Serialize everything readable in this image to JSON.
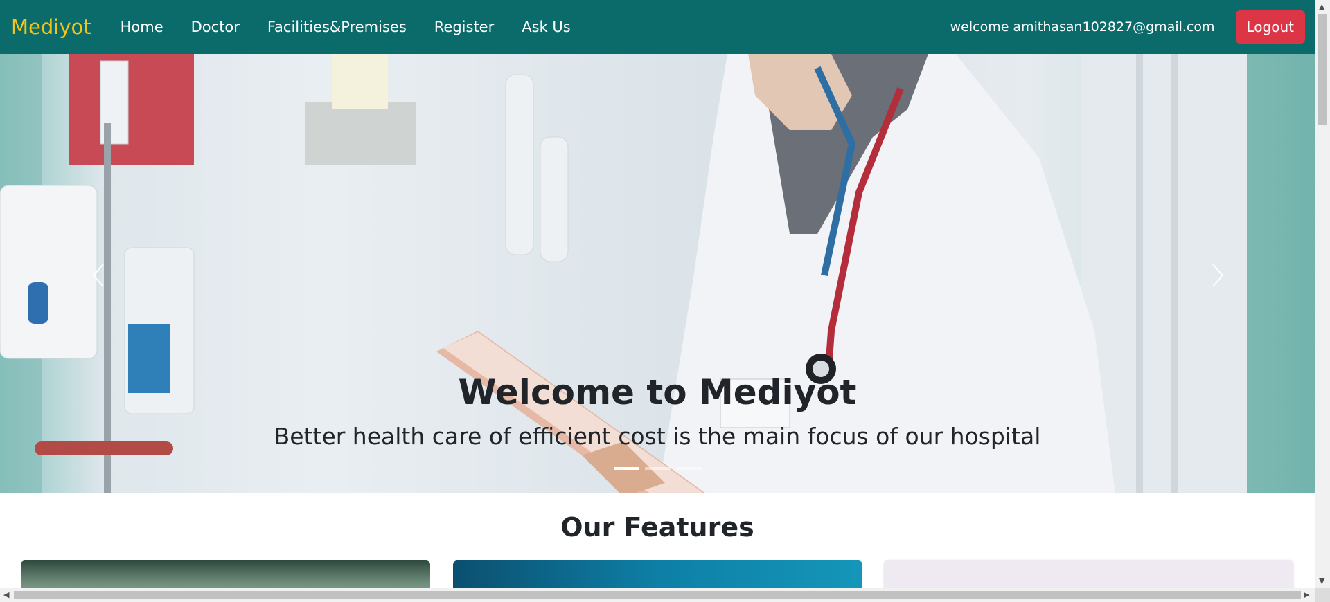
{
  "navbar": {
    "brand": "Mediyot",
    "links": [
      {
        "label": "Home"
      },
      {
        "label": "Doctor"
      },
      {
        "label": "Facilities&Premises"
      },
      {
        "label": "Register"
      },
      {
        "label": "Ask Us"
      }
    ],
    "welcome_text": "welcome amithasan102827@gmail.com",
    "logout_label": "Logout"
  },
  "hero": {
    "title": "Welcome to Mediyot",
    "subtitle": "Better health care of efficient cost is the main focus of our hospital",
    "prev_icon": "chevron-left-icon",
    "next_icon": "chevron-right-icon",
    "slide_count": 3,
    "active_slide": 1
  },
  "features": {
    "title": "Our Features"
  },
  "colors": {
    "navbar_bg": "#0b6b6b",
    "brand": "#f0c419",
    "logout_bg": "#dc3545"
  }
}
